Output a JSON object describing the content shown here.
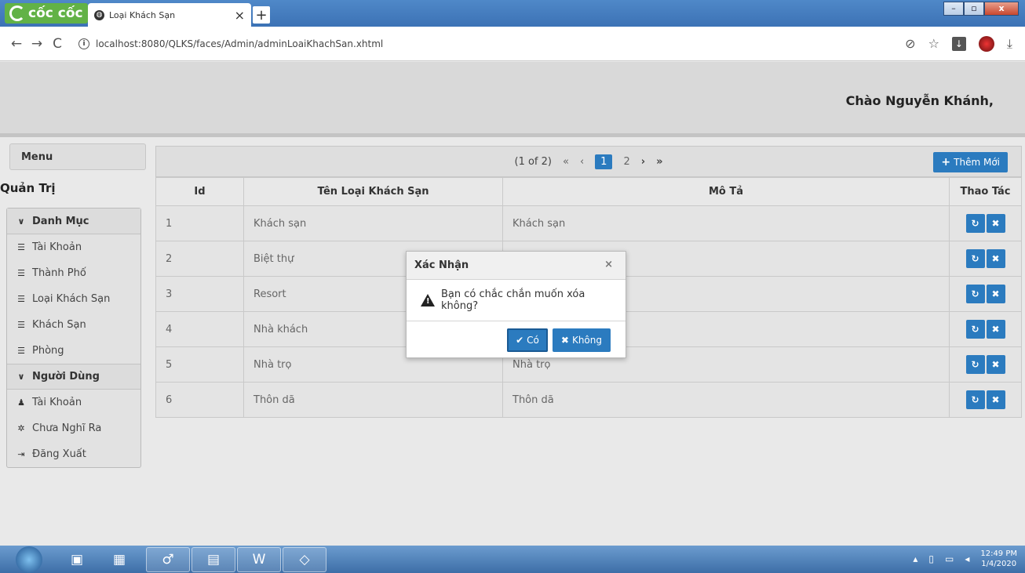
{
  "browser": {
    "brand": "cốc cốc",
    "tab_title": "Loại Khách Sạn",
    "tab_close": "×",
    "new_tab": "+",
    "url": "localhost:8080/QLKS/faces/Admin/adminLoaiKhachSan.xhtml",
    "window_controls": {
      "minimize": "–",
      "maximize": "▫",
      "close": "x"
    }
  },
  "header": {
    "greeting": "Chào Nguyễn Khánh,"
  },
  "sidebar": {
    "menu_label": "Menu",
    "admin_title": "Quản Trị",
    "danh_muc": {
      "label": "Danh Mục",
      "items": [
        {
          "label": "Tài Khoản",
          "icon": "list-icon"
        },
        {
          "label": "Thành Phố",
          "icon": "list-icon"
        },
        {
          "label": "Loại Khách Sạn",
          "icon": "list-icon"
        },
        {
          "label": "Khách Sạn",
          "icon": "list-icon"
        },
        {
          "label": "Phòng",
          "icon": "list-icon"
        }
      ]
    },
    "nguoi_dung": {
      "label": "Người Dùng",
      "items": [
        {
          "label": "Tài Khoản",
          "icon": "user-icon"
        },
        {
          "label": "Chưa Nghĩ Ra",
          "icon": "gear-icon"
        },
        {
          "label": "Đăng Xuất",
          "icon": "sign-out-icon"
        }
      ]
    }
  },
  "pager": {
    "summary": "(1 of 2)",
    "first": "«",
    "prev": "‹",
    "pages": [
      "1",
      "2"
    ],
    "current": "1",
    "next": "›",
    "last": "»",
    "add_label": "Thêm Mới"
  },
  "table": {
    "columns": [
      "Id",
      "Tên Loại Khách Sạn",
      "Mô Tả",
      "Thao Tác"
    ],
    "rows": [
      {
        "id": "1",
        "name": "Khách sạn",
        "desc": "Khách sạn"
      },
      {
        "id": "2",
        "name": "Biệt thự",
        "desc": ""
      },
      {
        "id": "3",
        "name": "Resort",
        "desc": ""
      },
      {
        "id": "4",
        "name": "Nhà khách",
        "desc": ""
      },
      {
        "id": "5",
        "name": "Nhà trọ",
        "desc": "Nhà trọ"
      },
      {
        "id": "6",
        "name": "Thôn dã",
        "desc": "Thôn dã"
      }
    ]
  },
  "dialog": {
    "title": "Xác Nhận",
    "close": "×",
    "message": "Bạn có chắc chắn muốn xóa không?",
    "yes": "Có",
    "no": "Không"
  },
  "taskbar": {
    "time": "12:49 PM",
    "date": "1/4/2020"
  },
  "colors": {
    "accent": "#2b7bbf",
    "header_bg": "#d9d9d9"
  }
}
